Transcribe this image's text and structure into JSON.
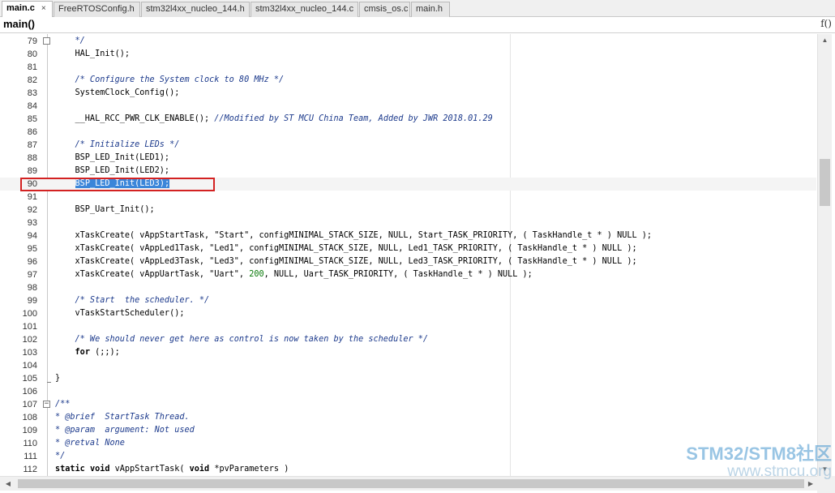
{
  "tabs": [
    {
      "label": "main.c",
      "close": "×",
      "active": true
    },
    {
      "label": "FreeRTOSConfig.h",
      "active": false
    },
    {
      "label": "stm32l4xx_nucleo_144.h",
      "active": false
    },
    {
      "label": "stm32l4xx_nucleo_144.c",
      "active": false
    },
    {
      "label": "cmsis_os.c",
      "active": false
    },
    {
      "label": "main.h",
      "active": false
    }
  ],
  "function_bar": {
    "name": "main()",
    "icon_text": "f()"
  },
  "editor": {
    "highlighted_line": "90",
    "lines": [
      {
        "n": "79",
        "code": "    */"
      },
      {
        "n": "80",
        "code": "    HAL_Init();"
      },
      {
        "n": "81",
        "code": ""
      },
      {
        "n": "82",
        "code": "    /* Configure the System clock to 80 MHz */"
      },
      {
        "n": "83",
        "code": "    SystemClock_Config();"
      },
      {
        "n": "84",
        "code": ""
      },
      {
        "n": "85",
        "code": "    __HAL_RCC_PWR_CLK_ENABLE(); //Modified by ST MCU China Team, Added by JWR 2018.01.29"
      },
      {
        "n": "86",
        "code": ""
      },
      {
        "n": "87",
        "code": "    /* Initialize LEDs */"
      },
      {
        "n": "88",
        "code": "    BSP_LED_Init(LED1);"
      },
      {
        "n": "89",
        "code": "    BSP_LED_Init(LED2);"
      },
      {
        "n": "90",
        "code": "    BSP_LED_Init(LED3);"
      },
      {
        "n": "91",
        "code": ""
      },
      {
        "n": "92",
        "code": "    BSP_Uart_Init();"
      },
      {
        "n": "93",
        "code": ""
      },
      {
        "n": "94",
        "code": "    xTaskCreate( vAppStartTask, \"Start\", configMINIMAL_STACK_SIZE, NULL, Start_TASK_PRIORITY, ( TaskHandle_t * ) NULL );"
      },
      {
        "n": "95",
        "code": "    xTaskCreate( vAppLed1Task, \"Led1\", configMINIMAL_STACK_SIZE, NULL, Led1_TASK_PRIORITY, ( TaskHandle_t * ) NULL );"
      },
      {
        "n": "96",
        "code": "    xTaskCreate( vAppLed3Task, \"Led3\", configMINIMAL_STACK_SIZE, NULL, Led3_TASK_PRIORITY, ( TaskHandle_t * ) NULL );"
      },
      {
        "n": "97",
        "code": "    xTaskCreate( vAppUartTask, \"Uart\", 200, NULL, Uart_TASK_PRIORITY, ( TaskHandle_t * ) NULL );"
      },
      {
        "n": "98",
        "code": ""
      },
      {
        "n": "99",
        "code": "    /* Start  the scheduler. */"
      },
      {
        "n": "100",
        "code": "    vTaskStartScheduler();"
      },
      {
        "n": "101",
        "code": ""
      },
      {
        "n": "102",
        "code": "    /* We should never get here as control is now taken by the scheduler */"
      },
      {
        "n": "103",
        "code": "    for (;;);"
      },
      {
        "n": "104",
        "code": ""
      },
      {
        "n": "105",
        "code": "}"
      },
      {
        "n": "106",
        "code": ""
      },
      {
        "n": "107",
        "code": "/**"
      },
      {
        "n": "108",
        "code": "* @brief  StartTask Thread."
      },
      {
        "n": "109",
        "code": "* @param  argument: Not used"
      },
      {
        "n": "110",
        "code": "* @retval None"
      },
      {
        "n": "111",
        "code": "*/"
      },
      {
        "n": "112",
        "code": "static void vAppStartTask( void *pvParameters )"
      }
    ]
  },
  "watermark": {
    "line1": "STM32/STM8社区",
    "line2": "www.stmcu.org"
  },
  "colors": {
    "comment": "#1c3a8c",
    "number": "#0a7a0a",
    "selection": "#3b86d9",
    "highlight_border": "#d32222"
  }
}
